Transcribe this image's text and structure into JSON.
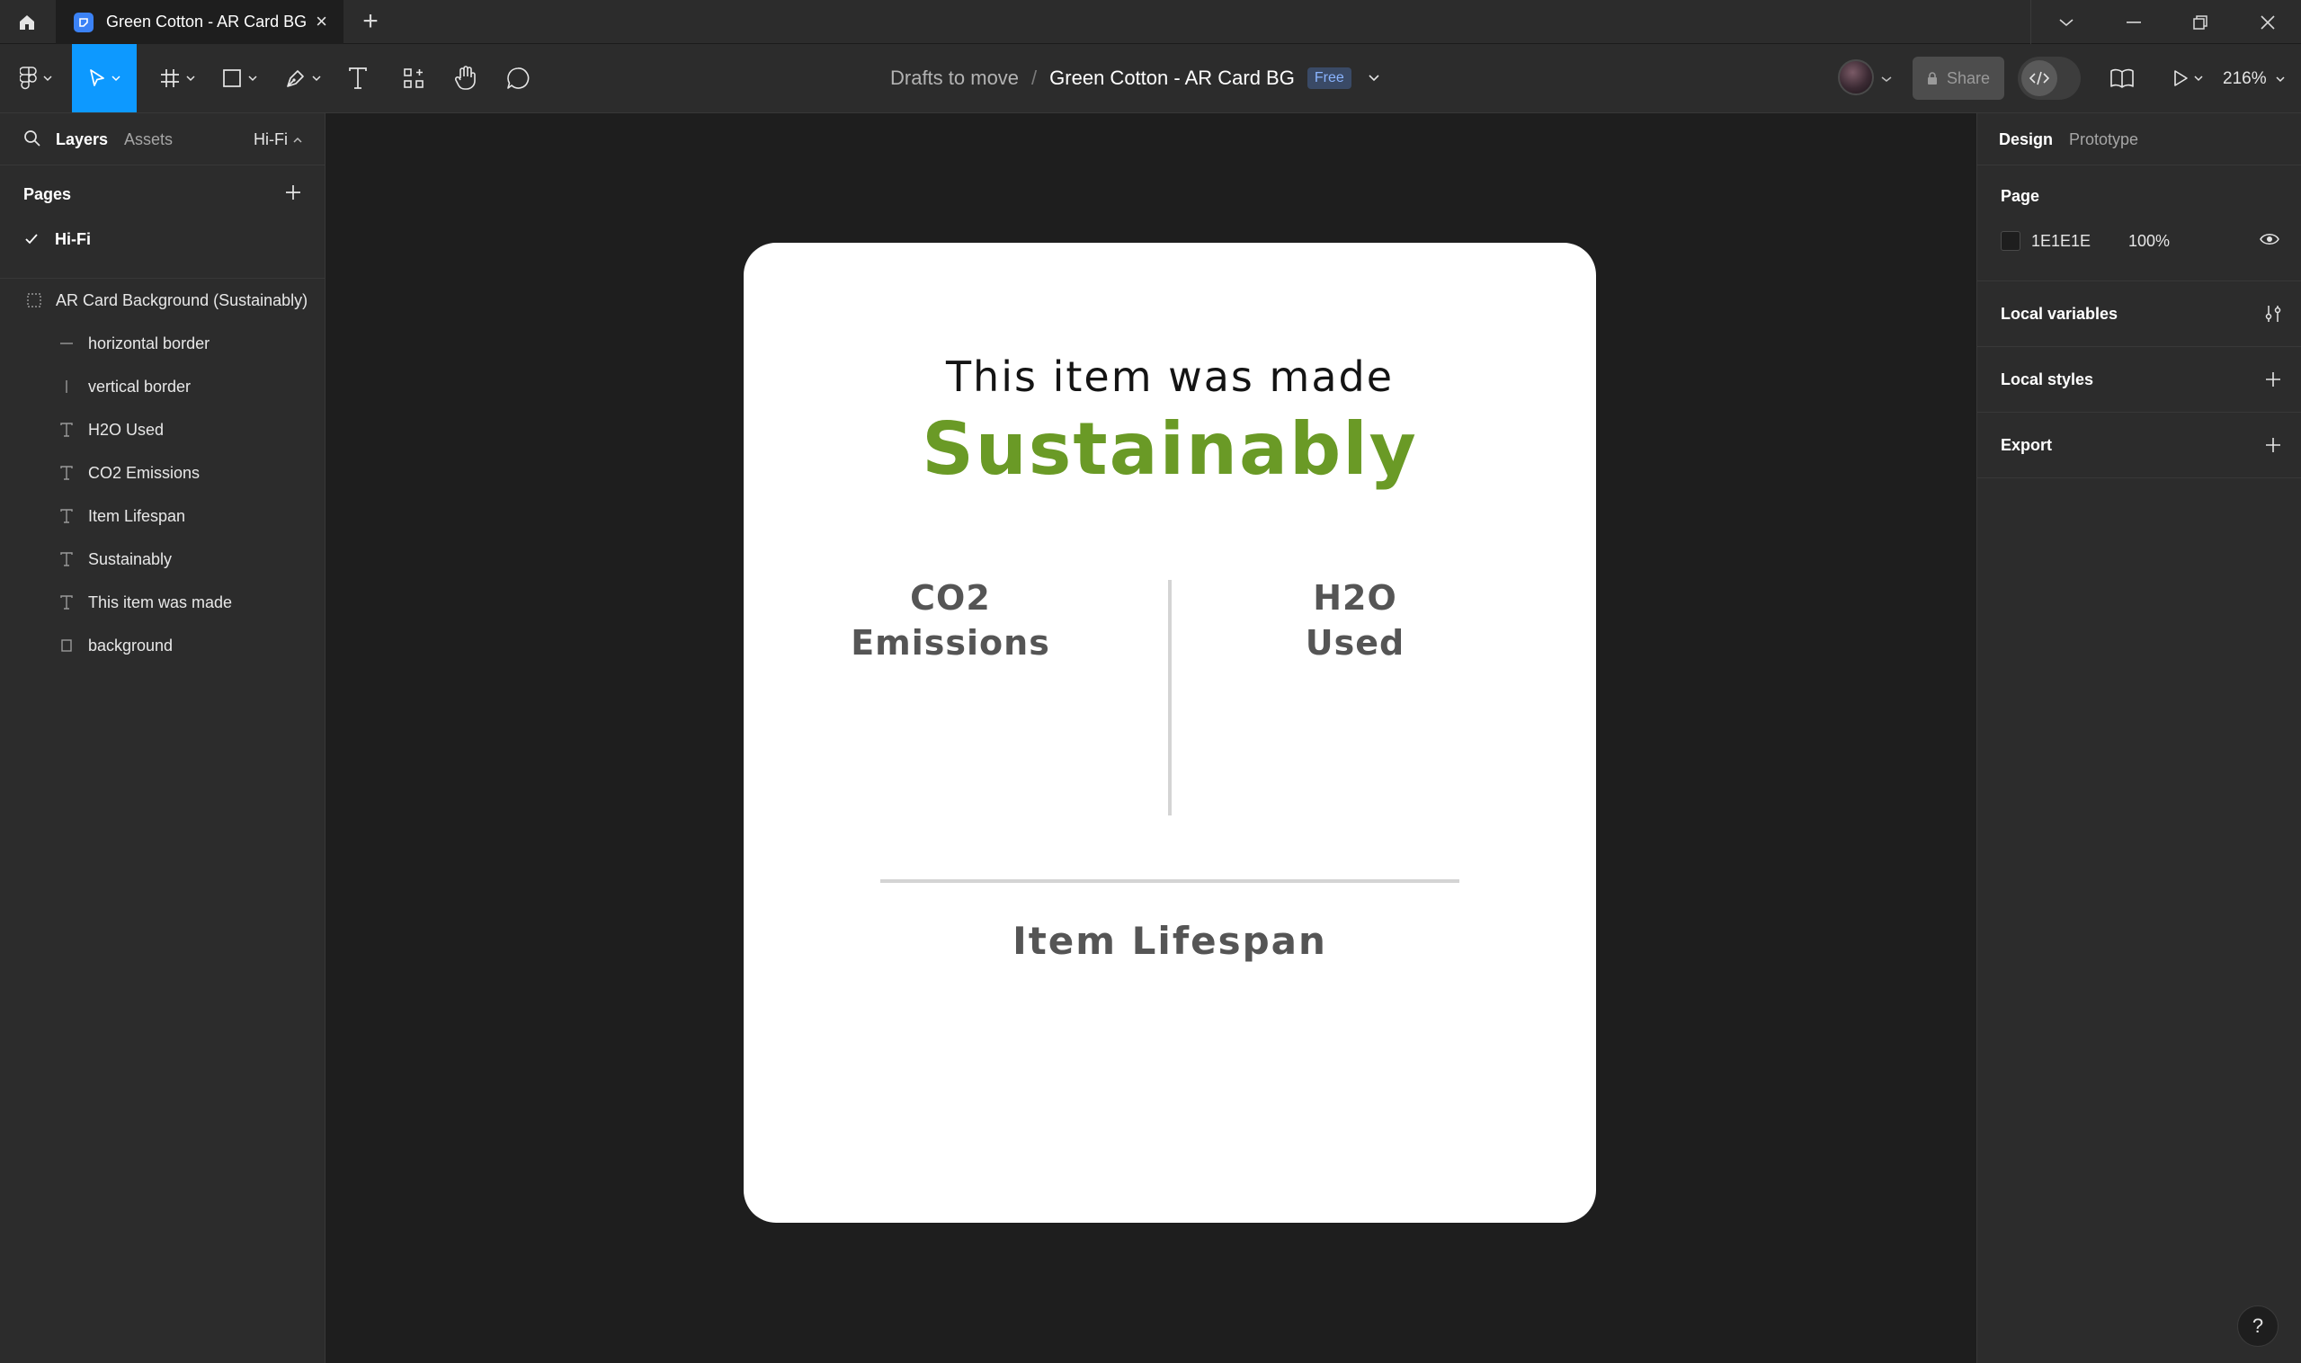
{
  "window": {
    "tab_title": "Green Cotton - AR Card BG",
    "tab_close": "×",
    "new_tab": "+",
    "controls": [
      "chevron-down-icon",
      "minimize-icon",
      "restore-icon",
      "close-icon"
    ]
  },
  "toolbar": {
    "tools": [
      "figma-menu-icon",
      "move-tool-icon",
      "frame-tool-icon",
      "shape-tool-icon",
      "pen-tool-icon",
      "text-tool-icon",
      "resources-icon",
      "hand-tool-icon",
      "comment-tool-icon"
    ],
    "breadcrumb_folder": "Drafts to move",
    "breadcrumb_sep": "/",
    "file_name": "Green Cotton - AR Card BG",
    "plan_badge": "Free",
    "share_label": "Share",
    "zoom_label": "216%"
  },
  "left_panel": {
    "tab_layers": "Layers",
    "tab_assets": "Assets",
    "current_page": "Hi-Fi",
    "pages_header": "Pages",
    "pages": [
      {
        "label": "Hi-Fi",
        "selected": true
      }
    ],
    "layers": [
      {
        "label": "AR Card Background (Sustainably)",
        "icon": "frame-icon"
      },
      {
        "label": "horizontal border",
        "icon": "line-icon"
      },
      {
        "label": "vertical border",
        "icon": "line-icon"
      },
      {
        "label": "H2O Used",
        "icon": "text-icon"
      },
      {
        "label": "CO2 Emissions",
        "icon": "text-icon"
      },
      {
        "label": "Item Lifespan",
        "icon": "text-icon"
      },
      {
        "label": "Sustainably",
        "icon": "text-icon"
      },
      {
        "label": "This item was made",
        "icon": "text-icon"
      },
      {
        "label": "background",
        "icon": "rectangle-icon"
      }
    ]
  },
  "canvas": {
    "card": {
      "heading": "This item was made",
      "highlight": "Sustainably",
      "co2_line1": "CO2",
      "co2_line2": "Emissions",
      "h2o_line1": "H2O",
      "h2o_line2": "Used",
      "lifespan": "Item Lifespan"
    },
    "colors": {
      "background": "#1E1E1E",
      "card": "#FFFFFF",
      "accent_green": "#6A9A26",
      "stat_gray": "#555555"
    }
  },
  "right_panel": {
    "tab_design": "Design",
    "tab_prototype": "Prototype",
    "page_section": "Page",
    "page_color_hex": "1E1E1E",
    "page_color_opacity": "100%",
    "local_variables": "Local variables",
    "local_styles": "Local styles",
    "export": "Export"
  },
  "help_label": "?"
}
